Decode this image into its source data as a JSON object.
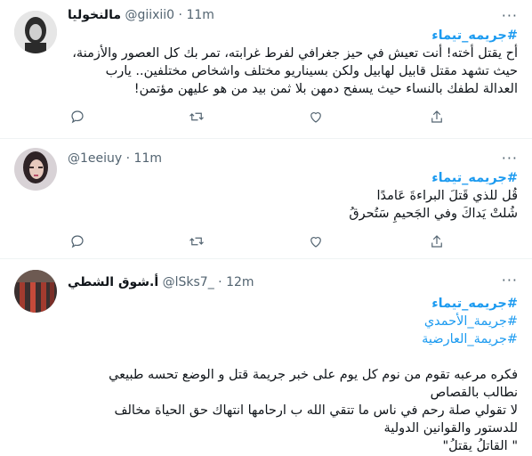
{
  "tweets": [
    {
      "display_name": "مالنخوليا",
      "handle": "@giixii0",
      "time": "11m",
      "hashtags": [
        "#جريمه_تيماء"
      ],
      "lines": [
        "أح يقتل أخته! أنت تعيش في حيز جغرافي لفرط غرابته، تمر بك كل العصور والأزمنة،",
        "حيث تشهد مقتل قابيل لهابيل ولكن بسيناريو مختلف واشخاص مختلفين.. يارب",
        "العدالة لطفك بالنساء حيث يسفح دمهن بلا ثمن بيد من هو عليهن مؤتمن!"
      ]
    },
    {
      "display_name": "",
      "handle": "@1eeiuy",
      "time": "11m",
      "hashtags": [
        "#جريمه_تيماء"
      ],
      "lines": [
        "قُل للذي قَتلَ البراءةَ عَامدًا",
        "شُلتْ يَداكَ وفي الجَحيمِ سَتُحرقُ"
      ]
    },
    {
      "display_name": "أ.شوق الشطي",
      "handle": "@lSks7_",
      "time": "12m",
      "hashtags": [
        "#جريمه_تيماء",
        "#جريمة_الأحمدي",
        "#جريمة_العارضية"
      ],
      "lines": [
        "فكره مرعبه تقوم من نوم كل يوم على خبر جريمة قتل و الوضع تحسه طبيعي",
        "نطالب بالقصاص",
        "لا تقولي صلة رحم في ناس ما تتقي الله ب ارحامها انتهاك حق الحياة مخالف",
        "للدستور والقوانين الدولية",
        "\" القاتلُ يقتلُ\""
      ]
    }
  ],
  "icons": [
    "reply-icon",
    "retweet-icon",
    "like-icon",
    "share-icon",
    "more-icon"
  ],
  "colors": {
    "hashtag": "#1d9bf0",
    "secondary": "#536471",
    "divider": "#eff3f4"
  }
}
